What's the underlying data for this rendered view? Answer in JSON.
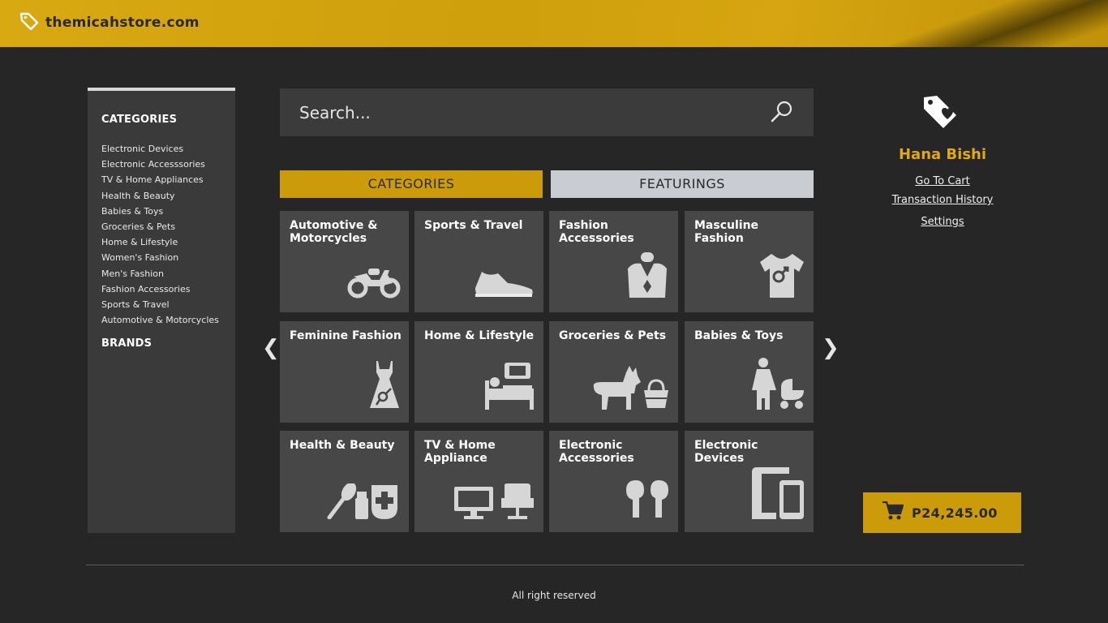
{
  "header": {
    "site_name": "themicahstore.com"
  },
  "sidebar": {
    "categories_heading": "CATEGORIES",
    "categories": [
      "Electronic Devices",
      "Electronic Accesssories",
      "TV & Home Appliances",
      "Health & Beauty",
      "Babies & Toys",
      "Groceries & Pets",
      "Home & Lifestyle",
      "Women's Fashion",
      "Men's Fashion",
      "Fashion Accessories",
      "Sports & Travel",
      "Automotive & Motorcycles"
    ],
    "brands_heading": "BRANDS"
  },
  "search": {
    "placeholder": "Search..."
  },
  "tabs": {
    "categories": "CATEGORIES",
    "featurings": "FEATURINGS"
  },
  "tiles": [
    {
      "label": "Automotive & Motorcycles",
      "icon": "motorcycle-icon"
    },
    {
      "label": "Sports & Travel",
      "icon": "sneaker-icon"
    },
    {
      "label": "Fashion Accessories",
      "icon": "necklace-icon"
    },
    {
      "label": "Masculine Fashion",
      "icon": "male-shirt-icon"
    },
    {
      "label": "Feminine Fashion",
      "icon": "female-dress-icon"
    },
    {
      "label": "Home & Lifestyle",
      "icon": "bed-tv-icon"
    },
    {
      "label": "Groceries & Pets",
      "icon": "dog-basket-icon"
    },
    {
      "label": "Babies & Toys",
      "icon": "mother-stroller-icon"
    },
    {
      "label": "Health & Beauty",
      "icon": "cosmetics-icon"
    },
    {
      "label": "TV & Home Appliance",
      "icon": "tv-chair-icon"
    },
    {
      "label": "Electronic Accessories",
      "icon": "earbuds-icon"
    },
    {
      "label": "Electronic Devices",
      "icon": "devices-icon"
    }
  ],
  "carousel": {
    "prev": "❮",
    "next": "❯"
  },
  "profile": {
    "name": "Hana Bishi",
    "links": {
      "cart": "Go To Cart",
      "history": "Transaction History",
      "settings": "Settings"
    }
  },
  "cart": {
    "amount": "P24,245.00"
  },
  "footer": {
    "text": "All right reserved"
  },
  "colors": {
    "accent": "#cc9b0a",
    "background": "#262626",
    "panel": "#3a3a3a",
    "tile": "#474747",
    "featurings_tab": "#c9ccd1"
  }
}
